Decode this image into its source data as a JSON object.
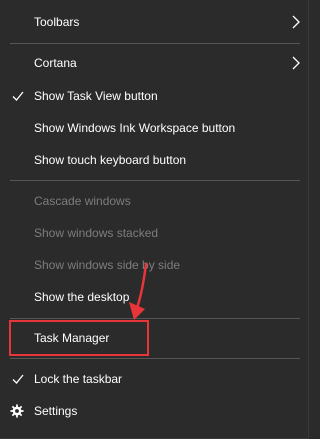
{
  "menu": {
    "items": [
      {
        "label": "Toolbars",
        "has_submenu": true,
        "checked": false,
        "enabled": true
      },
      {
        "label": "Cortana",
        "has_submenu": true,
        "checked": false,
        "enabled": true
      },
      {
        "label": "Show Task View button",
        "has_submenu": false,
        "checked": true,
        "enabled": true
      },
      {
        "label": "Show Windows Ink Workspace button",
        "has_submenu": false,
        "checked": false,
        "enabled": true
      },
      {
        "label": "Show touch keyboard button",
        "has_submenu": false,
        "checked": false,
        "enabled": true
      },
      {
        "label": "Cascade windows",
        "has_submenu": false,
        "checked": false,
        "enabled": false
      },
      {
        "label": "Show windows stacked",
        "has_submenu": false,
        "checked": false,
        "enabled": false
      },
      {
        "label": "Show windows side by side",
        "has_submenu": false,
        "checked": false,
        "enabled": false
      },
      {
        "label": "Show the desktop",
        "has_submenu": false,
        "checked": false,
        "enabled": true
      },
      {
        "label": "Task Manager",
        "has_submenu": false,
        "checked": false,
        "enabled": true,
        "highlighted": true
      },
      {
        "label": "Lock the taskbar",
        "has_submenu": false,
        "checked": true,
        "enabled": true
      },
      {
        "label": "Settings",
        "has_submenu": false,
        "checked": false,
        "enabled": true,
        "icon": "gear-icon"
      }
    ]
  },
  "annotation": {
    "highlight_color": "#e8353a"
  },
  "colors": {
    "menu_background": "#2b2b2b",
    "text": "#ffffff",
    "disabled_text": "#7d7d7d",
    "separator": "#555555"
  }
}
